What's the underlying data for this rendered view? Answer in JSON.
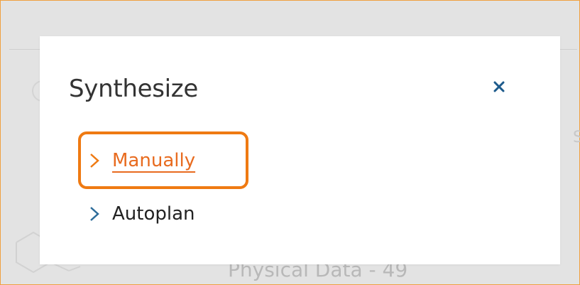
{
  "background": {
    "caption": "Physical Data - 49",
    "right_edge_glyph": "S"
  },
  "dialog": {
    "title": "Synthesize",
    "close_icon": "close-icon",
    "options": [
      {
        "label": "Manually",
        "icon": "chevron-right-icon",
        "state": "hover"
      },
      {
        "label": "Autoplan",
        "icon": "chevron-right-icon",
        "state": "default"
      }
    ]
  },
  "colors": {
    "accent_orange": "#ef7a12",
    "link_orange": "#e86b1f",
    "chevron_blue": "#2d6c9a",
    "close_blue": "#1d5b8c",
    "overlay_gray": "#e3e3e3"
  }
}
